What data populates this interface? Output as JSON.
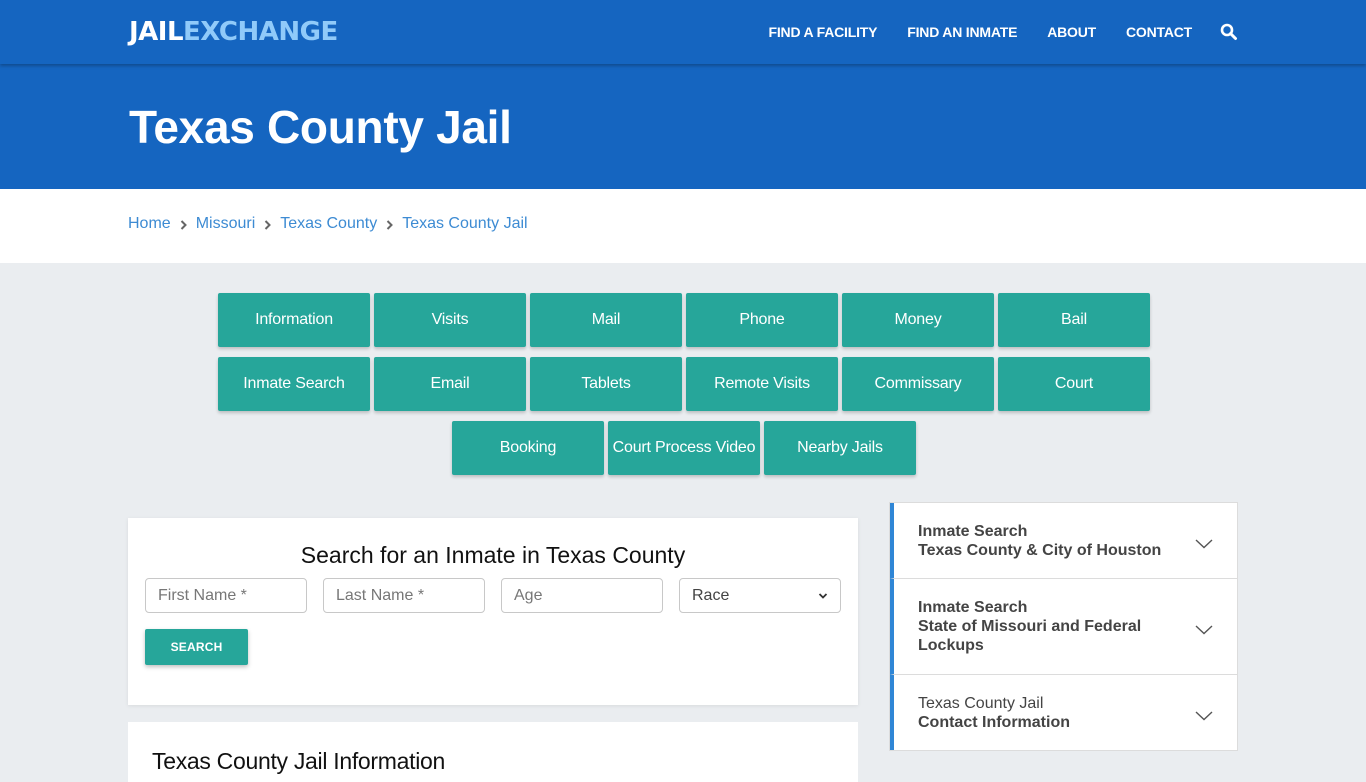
{
  "header": {
    "logo_part1": "JAIL",
    "logo_part2": "EXCHANGE",
    "nav": [
      {
        "label": "FIND A FACILITY"
      },
      {
        "label": "FIND AN INMATE"
      },
      {
        "label": "ABOUT"
      },
      {
        "label": "CONTACT"
      }
    ],
    "search_icon": "search-icon"
  },
  "hero": {
    "title": "Texas County Jail"
  },
  "breadcrumb": [
    {
      "label": "Home"
    },
    {
      "label": "Missouri"
    },
    {
      "label": "Texas County"
    },
    {
      "label": "Texas County Jail"
    }
  ],
  "tiles": [
    {
      "label": "Information"
    },
    {
      "label": "Visits"
    },
    {
      "label": "Mail"
    },
    {
      "label": "Phone"
    },
    {
      "label": "Money"
    },
    {
      "label": "Bail"
    },
    {
      "label": "Inmate Search"
    },
    {
      "label": "Email"
    },
    {
      "label": "Tablets"
    },
    {
      "label": "Remote Visits"
    },
    {
      "label": "Commissary"
    },
    {
      "label": "Court"
    },
    {
      "label": "Booking"
    },
    {
      "label": "Court Process Video"
    },
    {
      "label": "Nearby Jails"
    }
  ],
  "search_form": {
    "title": "Search for an Inmate in Texas County",
    "first_name_placeholder": "First Name *",
    "last_name_placeholder": "Last Name *",
    "age_placeholder": "Age",
    "race_selected": "Race",
    "submit_label": "SEARCH"
  },
  "info_section": {
    "title": "Texas County Jail Information"
  },
  "sidebar": {
    "items": [
      {
        "line1": "Inmate Search",
        "line2": "Texas County & City of Houston",
        "line1_bold": true
      },
      {
        "line1": "Inmate Search",
        "line2": "State of Missouri and Federal Lockups",
        "line1_bold": true
      },
      {
        "line1": "Texas County Jail",
        "line2": "Contact Information",
        "line1_bold": false
      }
    ]
  },
  "colors": {
    "brand_blue": "#1565c0",
    "logo_accent": "#90caf9",
    "teal": "#26a69a",
    "link_blue": "#3d8bd3",
    "accordion_accent": "#2f86d6"
  }
}
